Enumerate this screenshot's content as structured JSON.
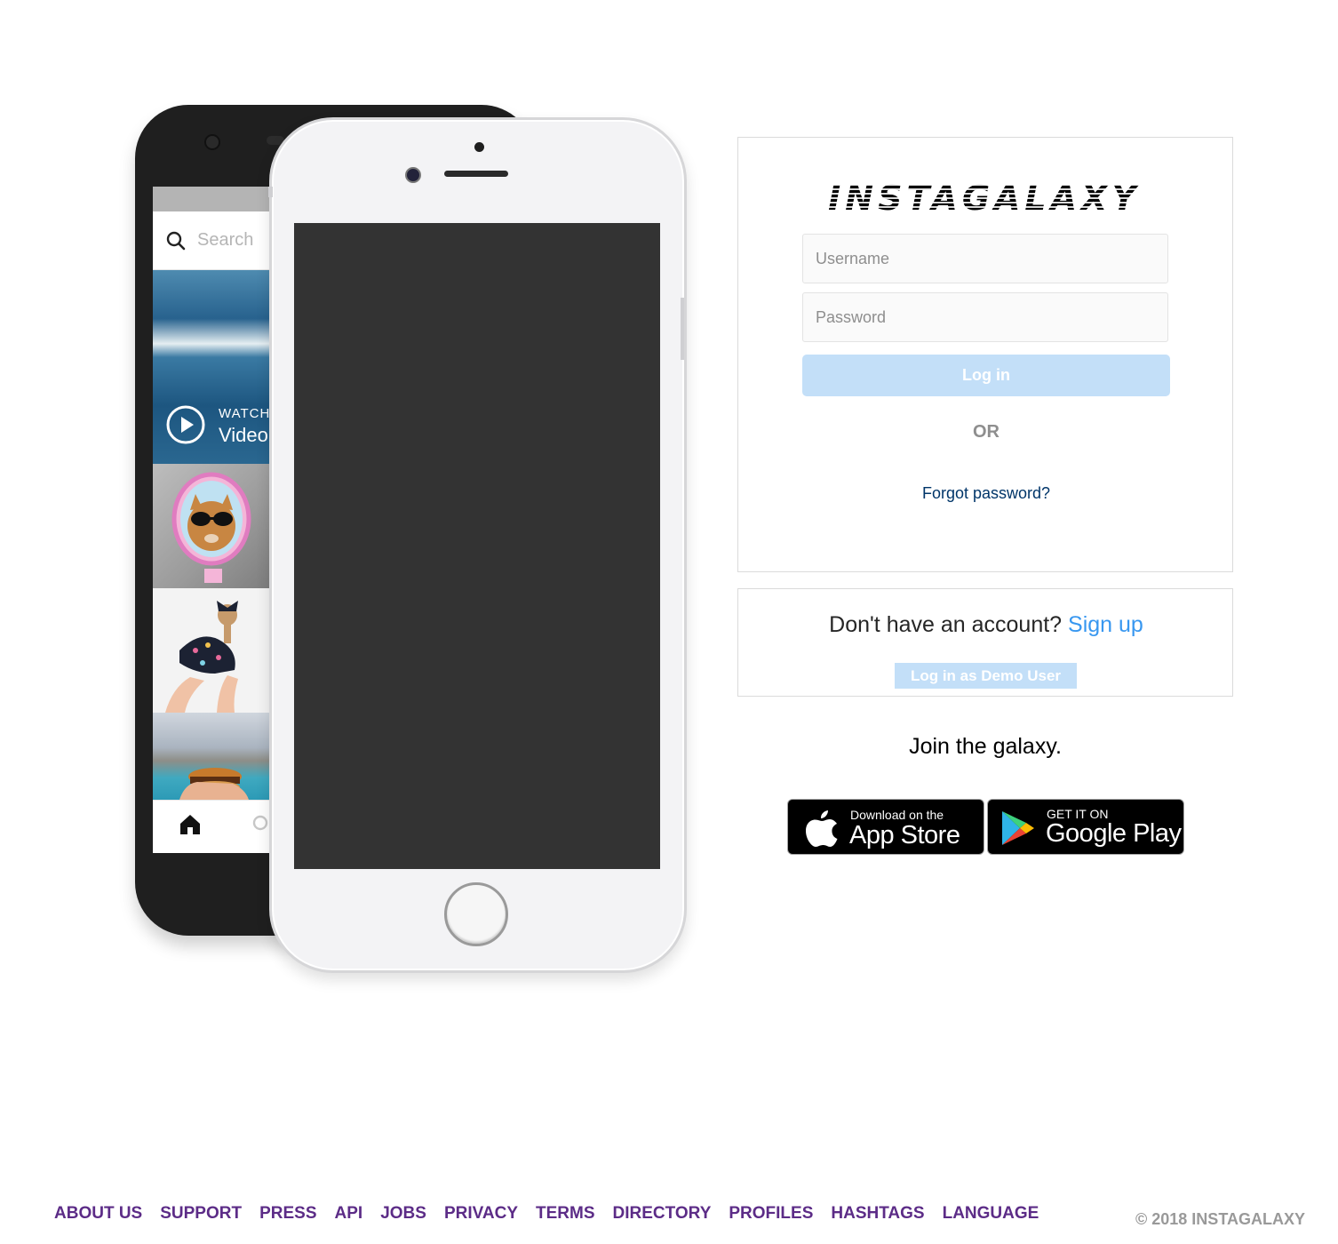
{
  "brand": {
    "logo_text": "INSTAGALAXY",
    "accent": "#3897f0",
    "disabled_button": "#c3dff8"
  },
  "phone_preview": {
    "search_placeholder": "Search",
    "video_tile": {
      "kicker": "WATCH",
      "title": "Video"
    }
  },
  "login": {
    "username_placeholder": "Username",
    "password_placeholder": "Password",
    "login_button": "Log in",
    "divider": "OR",
    "forgot_password": "Forgot password?"
  },
  "signup": {
    "prompt": "Don't have an account?",
    "link": "Sign up",
    "demo_button": "Log in as Demo User"
  },
  "download": {
    "tagline": "Join the galaxy.",
    "app_store": {
      "small": "Download on the",
      "big": "App Store",
      "icon": "apple-icon"
    },
    "google_play": {
      "small": "GET IT ON",
      "big": "Google Play",
      "icon": "google-play-icon"
    }
  },
  "footer": {
    "links": [
      "ABOUT US",
      "SUPPORT",
      "PRESS",
      "API",
      "JOBS",
      "PRIVACY",
      "TERMS",
      "DIRECTORY",
      "PROFILES",
      "HASHTAGS",
      "LANGUAGE"
    ],
    "copyright": "© 2018 INSTAGALAXY",
    "link_color": "#5c2c87"
  }
}
